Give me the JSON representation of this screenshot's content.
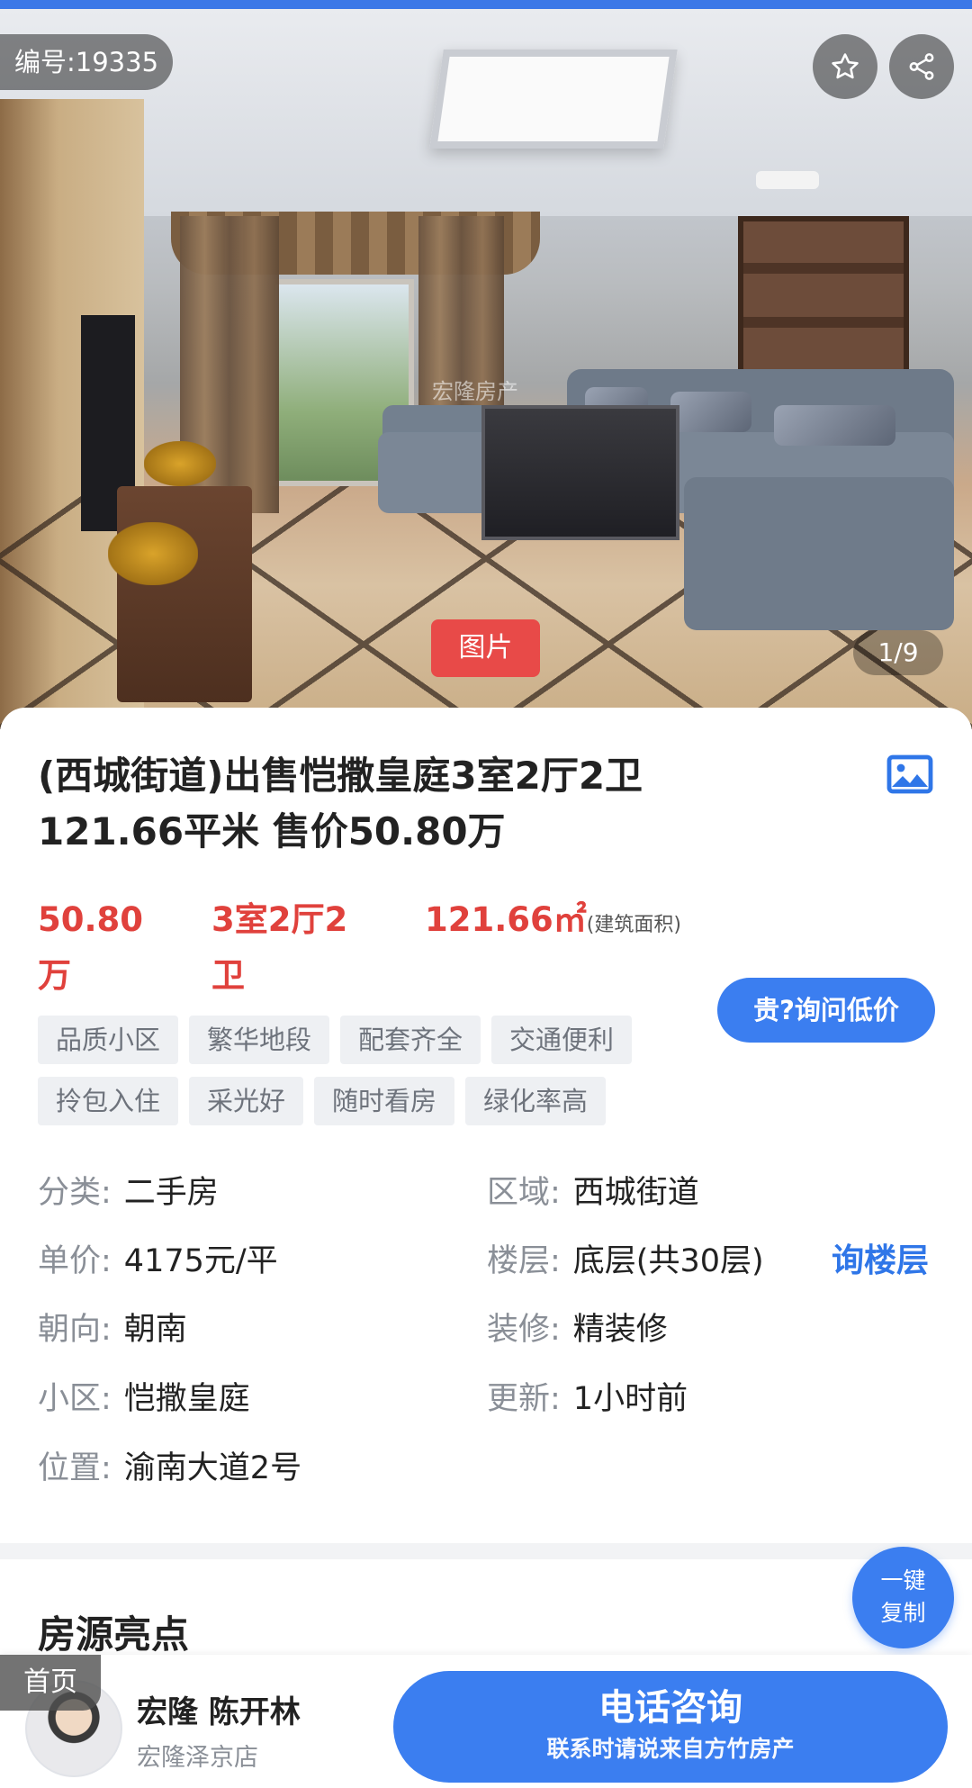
{
  "hero": {
    "listing_id": "编号:19335",
    "watermark": "宏隆房产",
    "photo_tag": "图片",
    "counter": "1/9"
  },
  "listing": {
    "title_line1": "(西城街道)出售恺撒皇庭3室2厅2卫",
    "title_line2": "121.66平米 售价50.80万",
    "price": "50.80万",
    "layout": "3室2厅2卫",
    "area_value": "121.66㎡",
    "area_unit": "(建筑面积)",
    "tags": [
      "品质小区",
      "繁华地段",
      "配套齐全",
      "交通便利",
      "拎包入住",
      "采光好",
      "随时看房",
      "绿化率高"
    ],
    "ask_price_button": "贵?询问低价"
  },
  "details": {
    "category": {
      "label": "分类:",
      "value": "二手房"
    },
    "district": {
      "label": "区域:",
      "value": "西城街道"
    },
    "unit_price": {
      "label": "单价:",
      "value": "4175元/平"
    },
    "floor": {
      "label": "楼层:",
      "value": "底层(共30层)"
    },
    "orientation": {
      "label": "朝向:",
      "value": "朝南"
    },
    "decoration": {
      "label": "装修:",
      "value": "精装修"
    },
    "community": {
      "label": "小区:",
      "value": "恺撒皇庭"
    },
    "updated": {
      "label": "更新:",
      "value": "1小时前"
    },
    "location": {
      "label": "位置:",
      "value": "渝南大道2号"
    },
    "ask_floor": "询楼层"
  },
  "section": {
    "highlights_title": "房源亮点",
    "copy_button": "一键复制"
  },
  "bottom": {
    "home_tab": "首页",
    "agent_name": "宏隆 陈开林",
    "agent_store": "宏隆泽京店",
    "call_label": "电话咨询",
    "call_sub": "联系时请说来自方竹房产"
  },
  "colors": {
    "accent": "#3b7ef0",
    "price_red": "#e0413c",
    "photo_tag_red": "#e84a48"
  }
}
